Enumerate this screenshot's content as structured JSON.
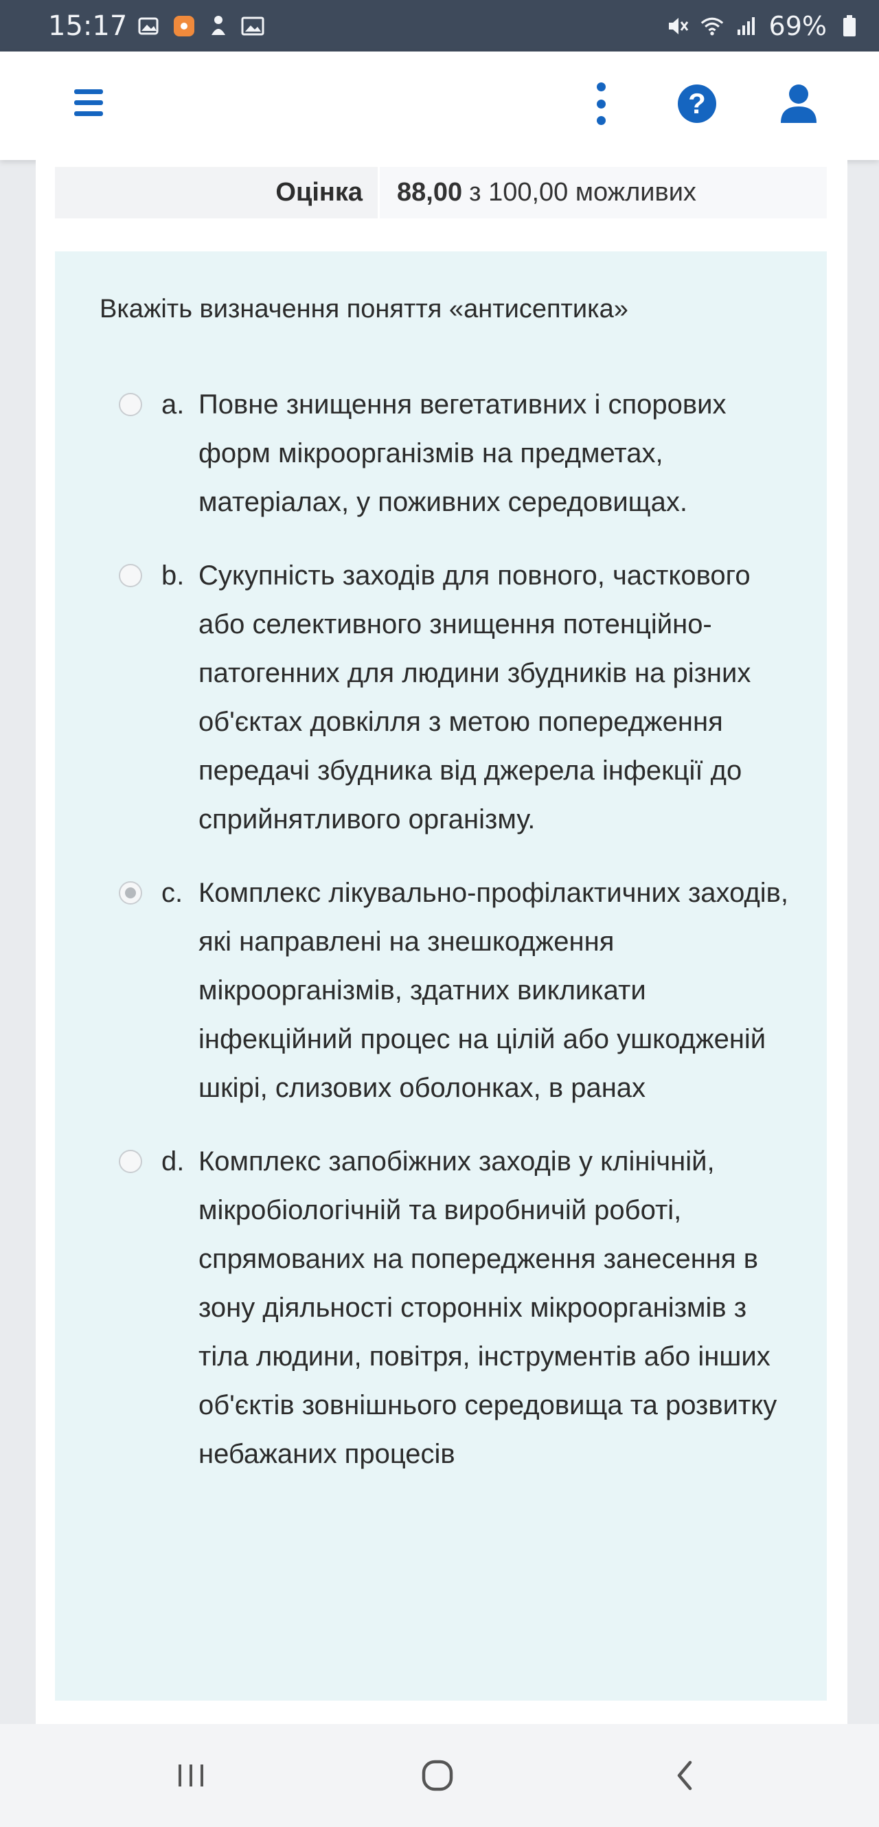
{
  "status_bar": {
    "time": "15:17",
    "battery": "69%",
    "icons": [
      "gallery-icon",
      "notification-dot-icon",
      "download-icon",
      "image-icon",
      "mute-icon",
      "wifi-icon",
      "signal-icon",
      "battery-icon"
    ]
  },
  "header": {
    "icons": [
      "menu-icon",
      "more-vertical-icon",
      "help-icon",
      "user-icon"
    ],
    "accent_color": "#1565c0"
  },
  "grade": {
    "label": "Оцінка",
    "score": "88,00",
    "suffix": "з 100,00 можливих"
  },
  "question": {
    "text": "Вкажіть визначення поняття «антисептика»",
    "answers": [
      {
        "letter": "a.",
        "text": "Повне знищення вегетативних і спорових форм мікроорганізмів на предметах, матеріалах, у поживних середовищах.",
        "selected": false
      },
      {
        "letter": "b.",
        "text": "Сукупність заходів для повного, часткового або селективного знищення потенційно-патогенних для людини збудників на різних об'єктах довкілля з метою попередження передачі збудника від джерела інфекції до сприйнятливого організму.",
        "selected": false
      },
      {
        "letter": "c.",
        "text": "Комплекс лікувально-профілактичних заходів, які направлені на знешкодження мікроорганізмів, здатних викликати інфекційний процес на цілій або ушкодженій шкірі, слизових оболонках, в ранах",
        "selected": true
      },
      {
        "letter": "d.",
        "text": "Комплекс запобіжних заходів у клінічній, мікробіологічній та виробничій роботі, спрямованих на попередження занесення в зону діяльності сторонніх мікроорганізмів з тіла людини, повітря, інструментів або інших об'єктів зовнішнього середовища та розвитку небажаних процесів",
        "selected": false
      }
    ],
    "background_color": "#e8f5f7"
  },
  "nav_bar": {
    "icons": [
      "recent-apps-icon",
      "home-icon",
      "back-icon"
    ]
  }
}
